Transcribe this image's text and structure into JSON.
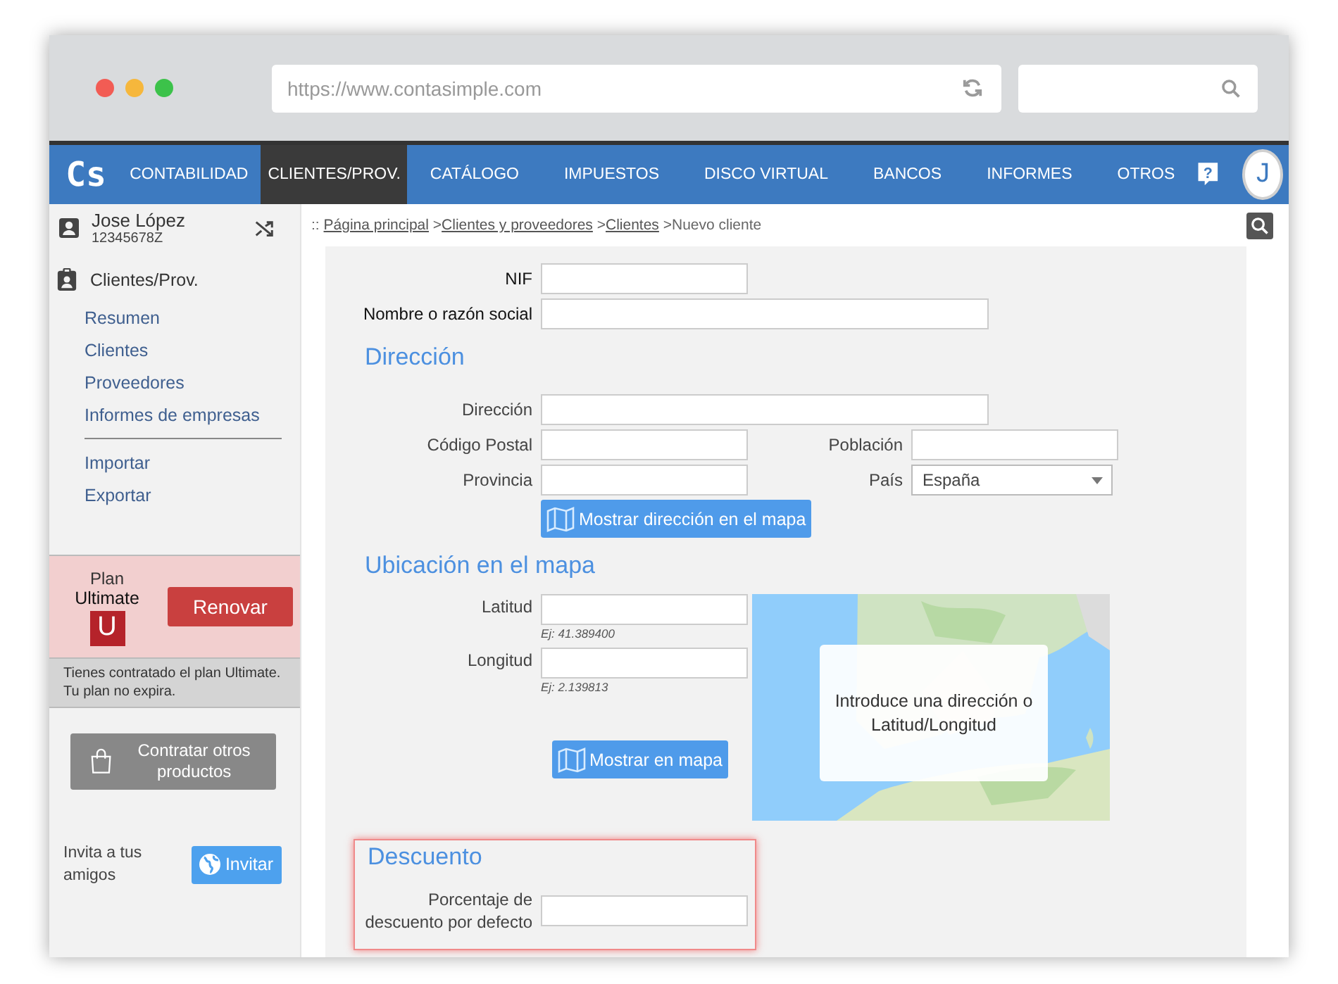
{
  "browser": {
    "url": "https://www.contasimple.com"
  },
  "nav": {
    "logo": "Cs",
    "help": "?",
    "avatar": "J",
    "items": [
      {
        "label": "CONTABILIDAD",
        "selected": false
      },
      {
        "label": "CLIENTES/PROV.",
        "selected": true
      },
      {
        "label": "CATÁLOGO",
        "selected": false
      },
      {
        "label": "IMPUESTOS",
        "selected": false
      },
      {
        "label": "DISCO VIRTUAL",
        "selected": false
      },
      {
        "label": "BANCOS",
        "selected": false
      },
      {
        "label": "INFORMES",
        "selected": false
      },
      {
        "label": "OTROS",
        "selected": false
      }
    ]
  },
  "user": {
    "name": "Jose López",
    "id": "12345678Z"
  },
  "breadcrumb": {
    "prefix": "::",
    "separator": ">",
    "links": [
      "Página principal",
      "Clientes y proveedores",
      "Clientes"
    ],
    "current": "Nuevo cliente"
  },
  "sidebar": {
    "section": "Clientes/Prov.",
    "groups": [
      [
        "Resumen",
        "Clientes",
        "Proveedores",
        "Informes de empresas"
      ],
      [
        "Importar",
        "Exportar"
      ]
    ]
  },
  "plan": {
    "label": "Plan",
    "name": "Ultimate",
    "badge": "U",
    "button": "Renovar",
    "note": [
      "Tienes contratado el plan Ultimate.",
      "Tu plan no expira."
    ]
  },
  "products_button": "Contratar otros productos",
  "invite": {
    "text": "Invita a tus amigos",
    "button": "Invitar"
  },
  "form": {
    "nif": {
      "label": "NIF"
    },
    "name": {
      "label": "Nombre o razón social"
    },
    "address": {
      "heading": "Dirección",
      "street": "Dirección",
      "postal": "Código Postal",
      "city": "Población",
      "province": "Provincia",
      "country": "País",
      "country_value": "España",
      "button": "Mostrar dirección en el mapa"
    },
    "location": {
      "heading": "Ubicación en el mapa",
      "lat": "Latitud",
      "lat_hint": "Ej: 41.389400",
      "lng": "Longitud",
      "lng_hint": "Ej: 2.139813",
      "button": "Mostrar en mapa",
      "map_message": "Introduce una dirección o Latitud/Longitud"
    },
    "discount": {
      "heading": "Descuento",
      "label": "Porcentaje de descuento por defecto"
    }
  }
}
